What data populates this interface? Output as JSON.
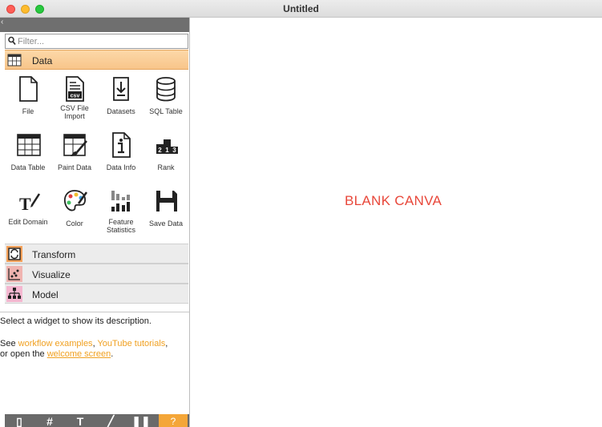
{
  "window": {
    "title": "Untitled"
  },
  "filter": {
    "placeholder": "Filter..."
  },
  "categories": {
    "data": {
      "label": "Data",
      "color": "#f8c58a"
    },
    "transform": {
      "label": "Transform",
      "color": "#f6a35c"
    },
    "visualize": {
      "label": "Visualize",
      "color": "#f0a4a0"
    },
    "model": {
      "label": "Model",
      "color": "#f4a7c4"
    }
  },
  "widgets": [
    {
      "label": "File",
      "icon": "file-icon"
    },
    {
      "label": "CSV File Import",
      "icon": "csv-file-icon"
    },
    {
      "label": "Datasets",
      "icon": "datasets-download-icon"
    },
    {
      "label": "SQL Table",
      "icon": "database-icon"
    },
    {
      "label": "Data Table",
      "icon": "table-grid-icon"
    },
    {
      "label": "Paint Data",
      "icon": "paint-brush-icon"
    },
    {
      "label": "Data Info",
      "icon": "info-icon"
    },
    {
      "label": "Rank",
      "icon": "rank-podium-icon"
    },
    {
      "label": "Edit Domain",
      "icon": "edit-text-icon"
    },
    {
      "label": "Color",
      "icon": "palette-icon"
    },
    {
      "label": "Feature Statistics",
      "icon": "bar-stats-icon"
    },
    {
      "label": "Save Data",
      "icon": "floppy-disk-icon"
    }
  ],
  "description": {
    "line1": "Select a widget to show its description.",
    "see": "See ",
    "workflow_link": "workflow examples",
    "comma": ", ",
    "youtube_link": "YouTube tutorials",
    "comma2": ",",
    "or_open": "or open the ",
    "welcome_link": "welcome screen",
    "period": "."
  },
  "toolbar": {
    "tools": [
      "file-icon",
      "grid-icon",
      "text-icon",
      "pen-icon",
      "pause-icon",
      "help-icon"
    ],
    "accent": "#f4a638"
  },
  "canvas": {
    "text": "BLANK CANVA",
    "color": "#e8473a"
  }
}
